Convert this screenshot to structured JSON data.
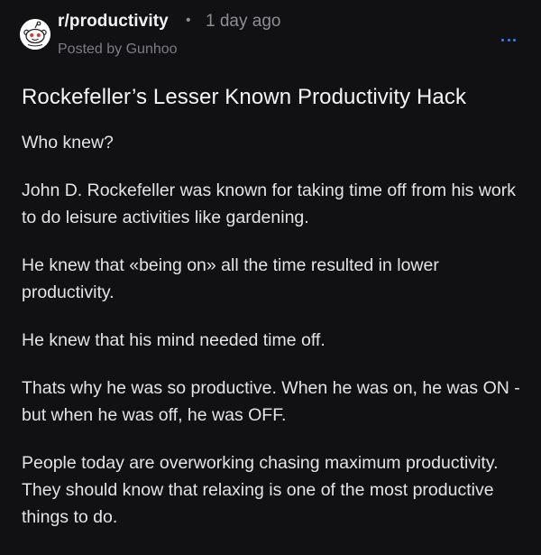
{
  "header": {
    "subreddit": "r/productivity",
    "separator": "•",
    "time_ago": "1 day ago",
    "posted_by": "Posted by Gunhoo",
    "more_icon": "more-horizontal-icon",
    "avatar_icon": "reddit-snoo-icon"
  },
  "post": {
    "title": "Rockefeller’s Lesser Known Productivity Hack",
    "paragraphs": [
      "Who knew?",
      "John D. Rockefeller was known for taking time off from his work to do leisure activities like gardening.",
      "He knew that «being on» all the time resulted in lower productivity.",
      "He knew that his mind needed time off.",
      "Thats why he was so productive. When he was on, he was ON - but when he was off, he was OFF.",
      "People today are overworking chasing maximum productivity. They should know that relaxing is one of the most productive things to do."
    ]
  },
  "colors": {
    "background": "#111113",
    "accent": "#2f86ff",
    "muted_text": "#8e8e93",
    "snoo_eyes": "#e0312b"
  }
}
